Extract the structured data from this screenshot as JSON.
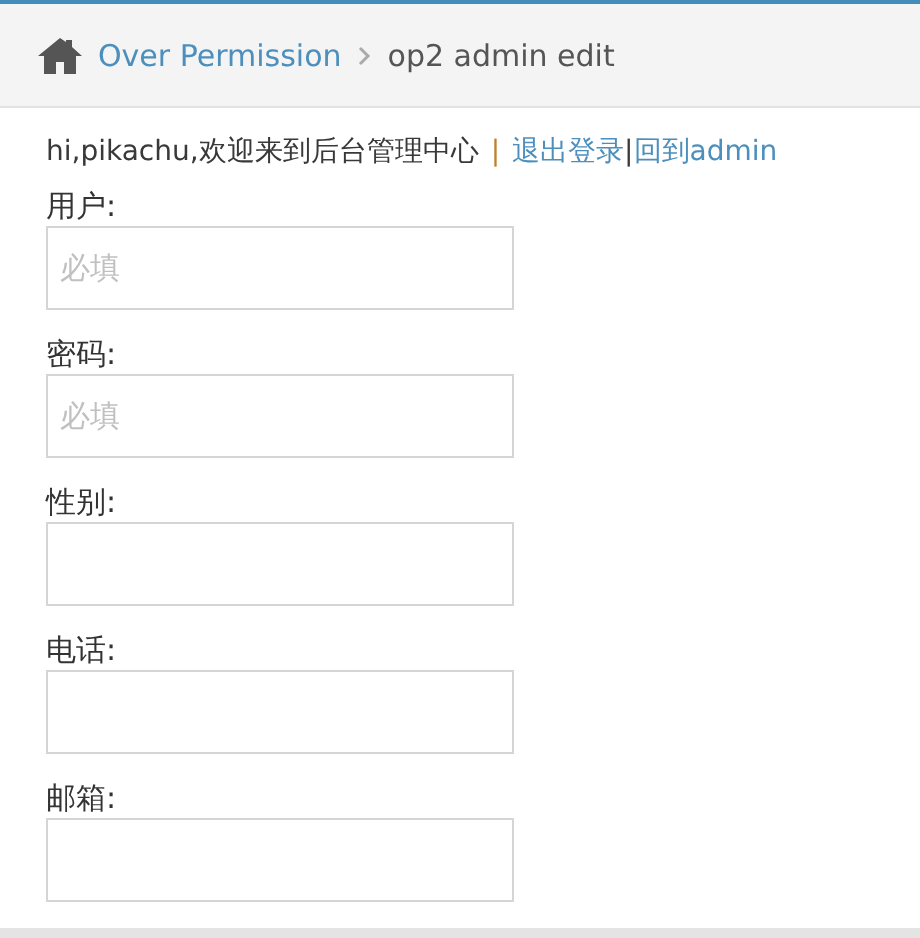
{
  "breadcrumb": {
    "items": [
      {
        "label": "Over Permission",
        "kind": "link"
      },
      {
        "label": "op2 admin edit",
        "kind": "current"
      }
    ]
  },
  "welcome": {
    "text": "hi,pikachu,欢迎来到后台管理中心",
    "separator": "|",
    "logout": "退出登录",
    "divider": "|",
    "back": "回到admin"
  },
  "fields": [
    {
      "label": "用户:",
      "placeholder": "必填"
    },
    {
      "label": "密码:",
      "placeholder": "必填"
    },
    {
      "label": "性别:"
    },
    {
      "label": "电话:"
    },
    {
      "label": "邮箱:"
    }
  ]
}
